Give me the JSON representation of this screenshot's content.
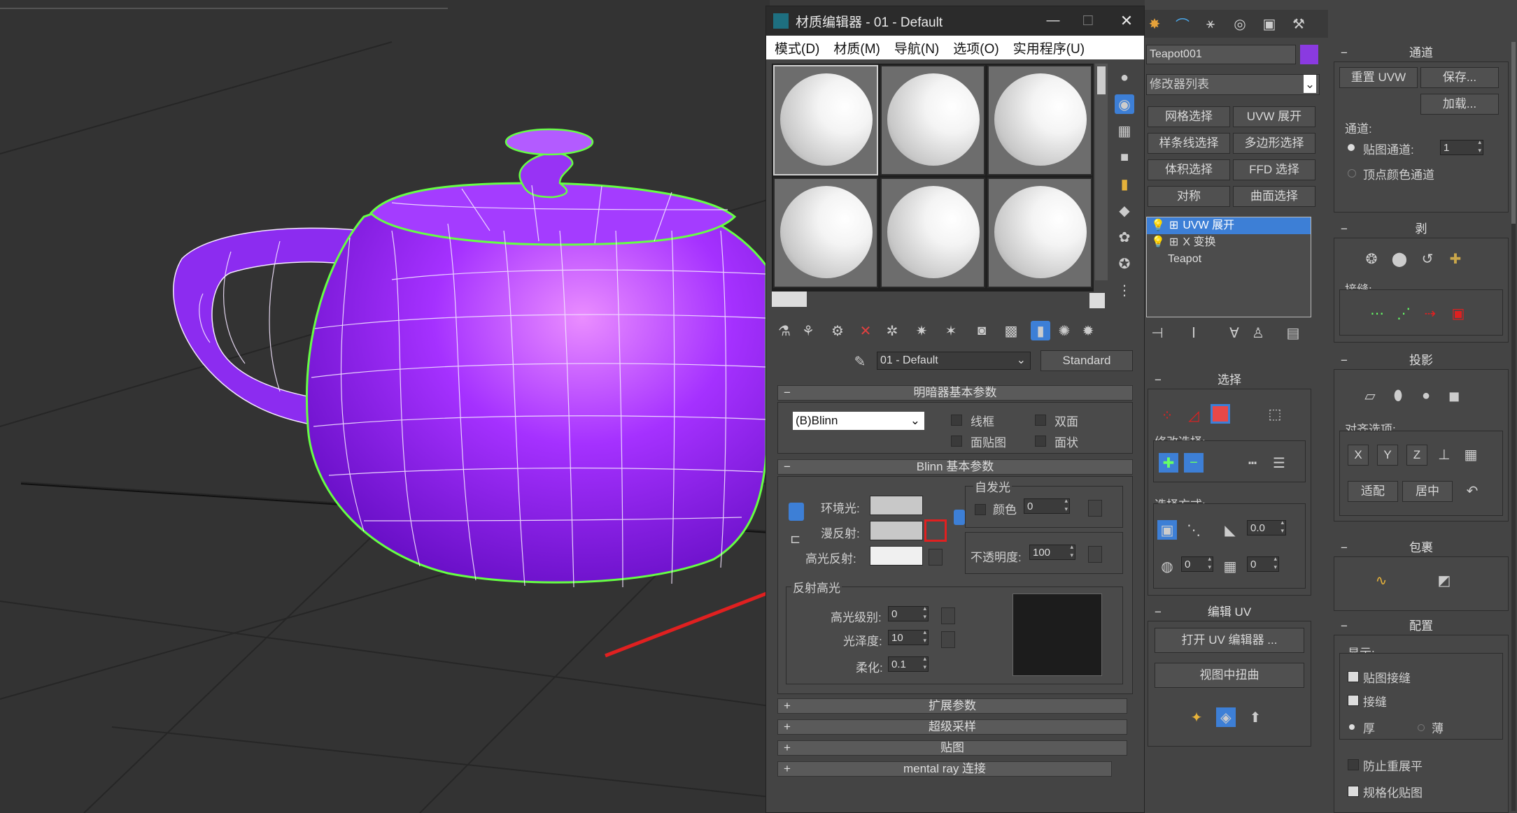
{
  "material_editor": {
    "title": "材质编辑器 - 01 - Default",
    "menu": [
      "模式(D)",
      "材质(M)",
      "导航(N)",
      "选项(O)",
      "实用程序(U)"
    ],
    "material_name": "01 - Default",
    "material_type": "Standard",
    "shader_params": {
      "title": "明暗器基本参数",
      "shader": "(B)Blinn",
      "wire_label": "线框",
      "two_sided_label": "双面",
      "face_map_label": "面贴图",
      "faceted_label": "面状"
    },
    "blinn_params": {
      "title": "Blinn 基本参数",
      "ambient_label": "环境光:",
      "diffuse_label": "漫反射:",
      "specular_label": "高光反射:",
      "self_illum_title": "自发光",
      "color_label": "颜色",
      "self_illum_value": "0",
      "opacity_label": "不透明度:",
      "opacity_value": "100",
      "spec_title": "反射高光",
      "spec_level_label": "高光级别:",
      "spec_level_value": "0",
      "gloss_label": "光泽度:",
      "gloss_value": "10",
      "soften_label": "柔化:",
      "soften_value": "0.1"
    },
    "rollouts": [
      "扩展参数",
      "超级采样",
      "贴图",
      "mental ray 连接"
    ]
  },
  "command_panel": {
    "object_name": "Teapot001",
    "object_color": "#8a3ae0",
    "modifier_list_placeholder": "修改器列表",
    "modifier_buttons": [
      "网格选择",
      "UVW 展开",
      "样条线选择",
      "多边形选择",
      "体积选择",
      "FFD 选择",
      "对称",
      "曲面选择"
    ],
    "stack": [
      "UVW 展开",
      "X 变换",
      "Teapot"
    ],
    "select_title": "选择",
    "modify_select_label": "修改选择:",
    "select_by_label": "选择方式:",
    "spinner_a": "0.0",
    "spinner_b": "0",
    "spinner_c": "0",
    "edit_uv_title": "编辑 UV",
    "open_uv_editor": "打开 UV 编辑器 ...",
    "tweak_in_view": "视图中扭曲",
    "channel": {
      "title": "通道",
      "reset_uvw": "重置 UVW",
      "save": "保存...",
      "load": "加载...",
      "channel_label": "通道:",
      "map_channel_label": "贴图通道:",
      "map_channel_value": "1",
      "vertex_color_label": "顶点颜色通道"
    },
    "peel": {
      "title": "剥",
      "seams_label": "接缝:"
    },
    "projection": {
      "title": "投影",
      "align_label": "对齐选项:",
      "axes": [
        "X",
        "Y",
        "Z"
      ],
      "fit": "适配",
      "center": "居中"
    },
    "wrap": {
      "title": "包裹"
    },
    "config": {
      "title": "配置",
      "display_label": "显示:",
      "map_seams": "贴图接缝",
      "seams": "接缝",
      "thick": "厚",
      "thin": "薄",
      "prevent_reflatten": "防止重展平",
      "normalize_map": "规格化贴图"
    }
  },
  "colors": {
    "teapot": "#9b2bff",
    "teapot_highlight": "#e58cff",
    "selection_outline": "#66ff44",
    "arrow": "#e02020",
    "highlight_box": "#e02020",
    "stack_selected": "#3d7fd6"
  }
}
